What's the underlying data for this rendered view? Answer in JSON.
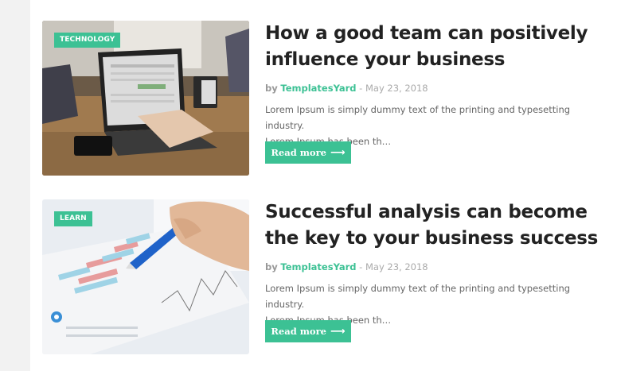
{
  "posts": [
    {
      "category": "TECHNOLOGY",
      "title_line1": "How a good team can positively",
      "title_line2": "influence your business",
      "by_label": "by",
      "author": "TemplatesYard",
      "date": "- May 23, 2018",
      "excerpt_line1": "Lorem Ipsum is simply dummy text of the printing and typesetting industry.",
      "excerpt_line2": "Lorem Ipsum has been th…",
      "button_label": "Read more",
      "button_icon": "arrow-right-icon"
    },
    {
      "category": "LEARN",
      "title_line1": "Successful analysis can become",
      "title_line2": "the key to your business success",
      "by_label": "by",
      "author": "TemplatesYard",
      "date": "- May 23, 2018",
      "excerpt_line1": "Lorem Ipsum is simply dummy text of the printing and typesetting industry.",
      "excerpt_line2": "Lorem Ipsum has been th…",
      "button_label": "Read more",
      "button_icon": "arrow-right-icon"
    }
  ],
  "colors": {
    "accent": "#3cc194",
    "title": "#222222",
    "text": "#666666",
    "muted": "#999999"
  }
}
